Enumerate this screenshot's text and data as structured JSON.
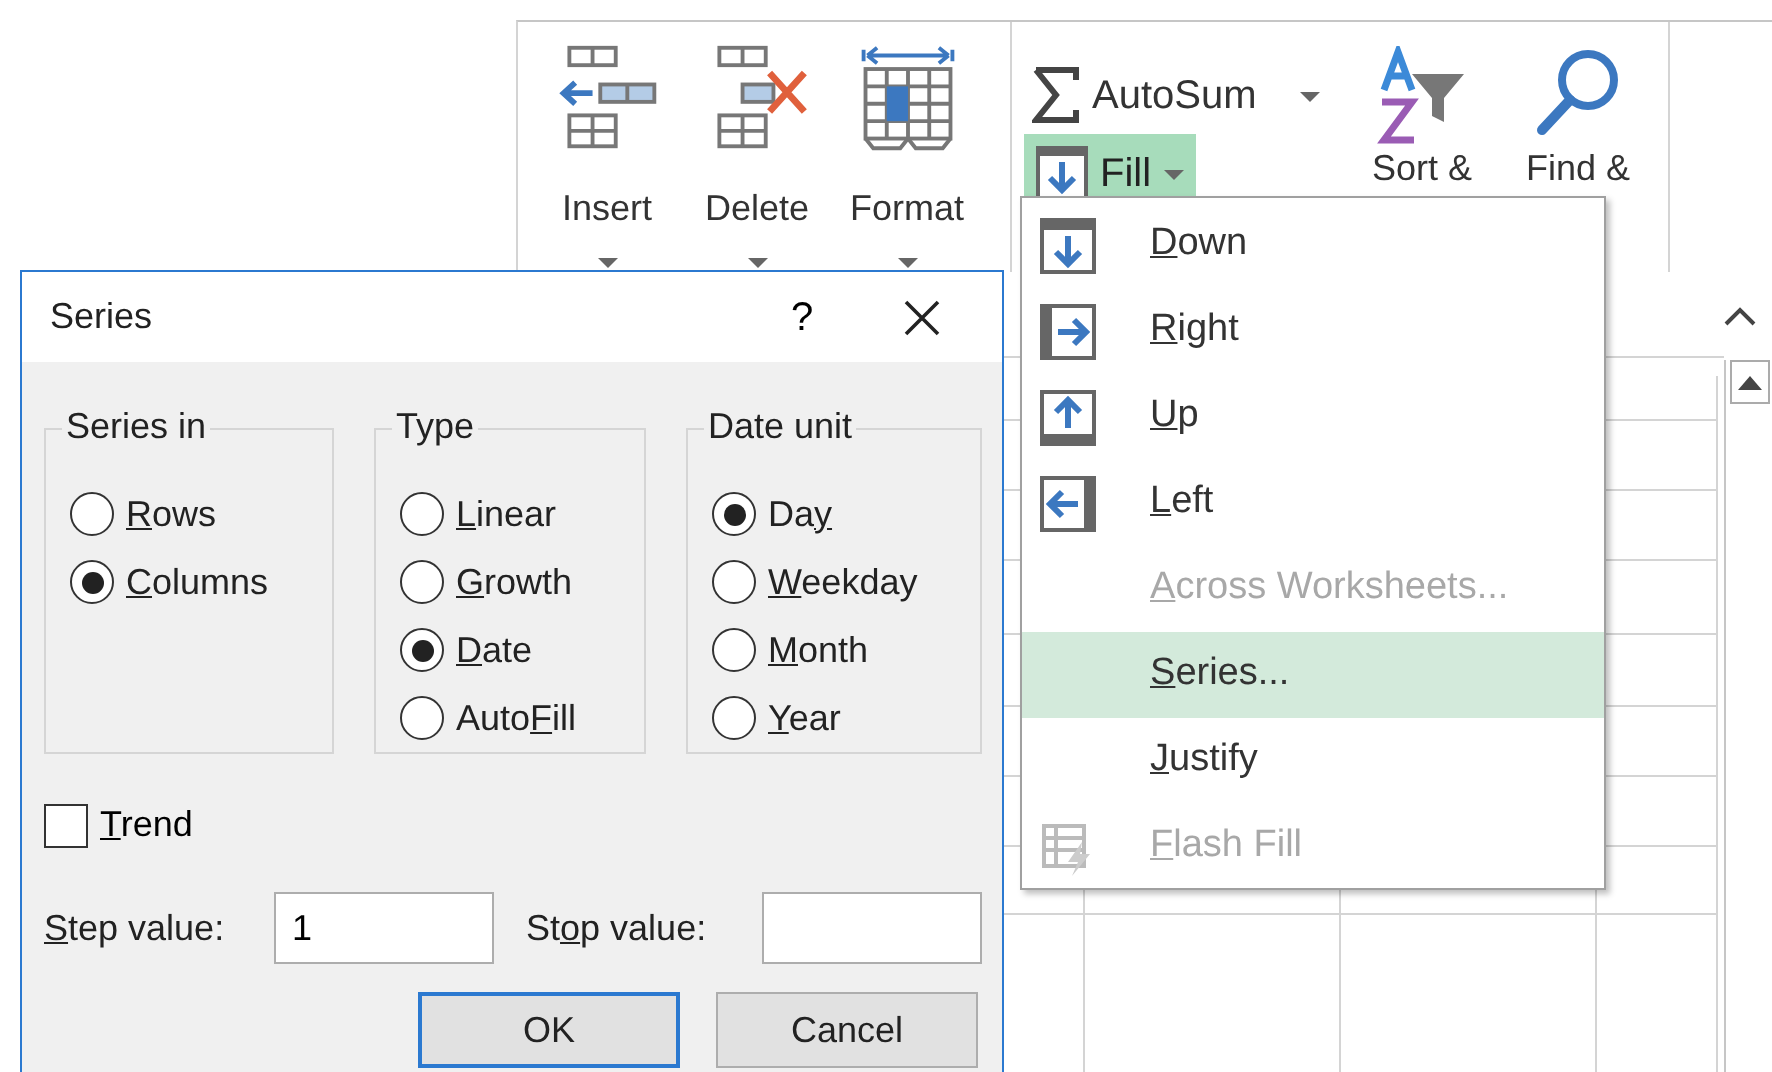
{
  "ribbon": {
    "cells_buttons": [
      {
        "kind": "insert",
        "label": "Insert"
      },
      {
        "kind": "delete",
        "label": "Delete"
      },
      {
        "kind": "format",
        "label": "Format"
      }
    ],
    "editing": {
      "autosum": "AutoSum",
      "fill": {
        "label": "Fill",
        "pressed": true
      },
      "sort": "Sort &",
      "find": "Find &"
    }
  },
  "fill_menu": {
    "items": [
      {
        "kind": "down",
        "label": {
          "key": "D",
          "after": "own"
        },
        "disabled": false,
        "highlighted": false
      },
      {
        "kind": "right",
        "label": {
          "key": "R",
          "after": "ight"
        },
        "disabled": false,
        "highlighted": false
      },
      {
        "kind": "up",
        "label": {
          "key": "U",
          "after": "p"
        },
        "disabled": false,
        "highlighted": false
      },
      {
        "kind": "left",
        "label": {
          "key": "L",
          "after": "eft"
        },
        "disabled": false,
        "highlighted": false
      },
      {
        "kind": "plain",
        "label": {
          "key": "A",
          "after": "cross Worksheets..."
        },
        "disabled": true,
        "highlighted": false
      },
      {
        "kind": "plain",
        "label": {
          "key": "S",
          "after": "eries..."
        },
        "disabled": false,
        "highlighted": true
      },
      {
        "kind": "plain",
        "label": {
          "key": "J",
          "after": "ustify"
        },
        "disabled": false,
        "highlighted": false
      },
      {
        "kind": "flash",
        "label": {
          "key": "F",
          "after": "lash Fill"
        },
        "disabled": true,
        "highlighted": false
      }
    ]
  },
  "dialog": {
    "title": "Series",
    "help": "?",
    "groups": [
      {
        "title": "Series in",
        "options": [
          {
            "label": {
              "key": "R",
              "after": "ows"
            },
            "selected": false
          },
          {
            "label": {
              "key": "C",
              "after": "olumns"
            },
            "selected": true
          }
        ]
      },
      {
        "title": "Type",
        "options": [
          {
            "label": {
              "key": "L",
              "after": "inear"
            },
            "selected": false
          },
          {
            "label": {
              "key": "G",
              "after": "rowth"
            },
            "selected": false
          },
          {
            "label": {
              "key": "D",
              "after": "ate"
            },
            "selected": true
          },
          {
            "label": {
              "before": "Auto",
              "key": "F",
              "after": "ill"
            },
            "selected": false
          }
        ]
      },
      {
        "title": "Date unit",
        "options": [
          {
            "label": {
              "before": "Da",
              "key": "y"
            },
            "selected": true
          },
          {
            "label": {
              "key": "W",
              "after": "eekday"
            },
            "selected": false
          },
          {
            "label": {
              "key": "M",
              "after": "onth"
            },
            "selected": false
          },
          {
            "label": {
              "key": "Y",
              "after": "ear"
            },
            "selected": false
          }
        ]
      }
    ],
    "trend": {
      "label": {
        "key": "T",
        "after": "rend"
      },
      "checked": false
    },
    "step": {
      "label": {
        "key": "S",
        "after": "tep value:"
      },
      "value": "1"
    },
    "stop": {
      "label": {
        "before": "St",
        "key": "o",
        "after": "p value:"
      }
    },
    "buttons": [
      {
        "label": "OK",
        "default": true
      },
      {
        "label": "Cancel",
        "default": false
      }
    ]
  }
}
